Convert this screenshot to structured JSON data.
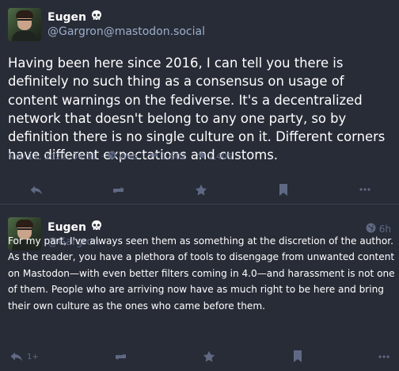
{
  "main_post": {
    "author_name": "Eugen",
    "author_handle": "@Gargron@mastodon.social",
    "content": "Having been here since 2016, I can tell you there is definitely no such thing as a consensus on usage of content warnings on the fediverse. It's a decentralized network that doesn't belong to any one party, so by definition there is no single culture on it. Different corners have different expectations and customs.",
    "timestamp": "Nov 11, 2022, 04:31",
    "visibility_label": "Web",
    "boost_count": "1,602",
    "favourite_count": "2,405"
  },
  "reply_post": {
    "author_name": "Eugen",
    "author_handle": "@Gargron",
    "relative_time": "6h",
    "content": "For my part, I've always seen them as something at the discretion of the author. As the reader, you have a plethora of tools to disengage from unwanted content on Mastodon—with even better filters coming in 4.0—and harassment is not one of them. People who are arriving now have as much right to be here and bring their own culture as the ones who came before them.",
    "reply_count": "1+"
  },
  "icons": {
    "skull": "skull-icon",
    "reply": "reply-icon",
    "boost": "boost-icon",
    "favourite": "star-icon",
    "bookmark": "bookmark-icon",
    "more": "more-icon",
    "globe": "globe-icon"
  },
  "colors": {
    "background": "#282c37",
    "text": "#ffffff",
    "handle": "#9baec8",
    "muted": "#606984"
  }
}
